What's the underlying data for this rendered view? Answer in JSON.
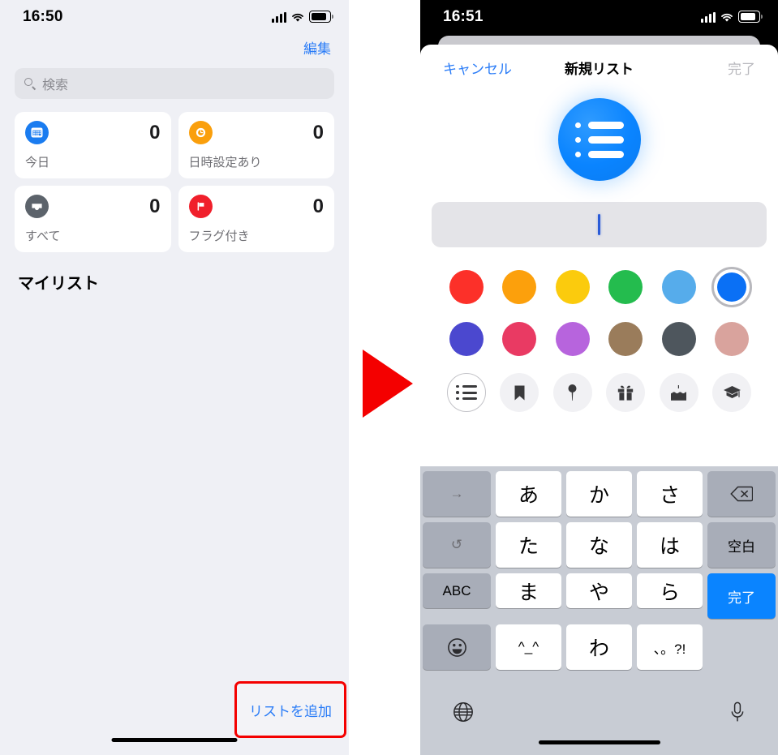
{
  "left_phone": {
    "status_bar": {
      "time": "16:50",
      "signal_icon": "cellular-bars-icon",
      "wifi_icon": "wifi-icon",
      "battery_icon": "battery-icon"
    },
    "edit_button": "編集",
    "search": {
      "placeholder": "検索",
      "icon": "search-icon"
    },
    "cards": [
      {
        "label": "今日",
        "count": "0",
        "icon": "calendar-icon",
        "color": "#1a7cf0"
      },
      {
        "label": "日時設定あり",
        "count": "0",
        "icon": "clock-icon",
        "color": "#fa9f0c"
      },
      {
        "label": "すべて",
        "count": "0",
        "icon": "inbox-icon",
        "color": "#5c636b"
      },
      {
        "label": "フラグ付き",
        "count": "0",
        "icon": "flag-icon",
        "color": "#f01f2b"
      }
    ],
    "my_lists_heading": "マイリスト",
    "add_list_button": "リストを追加",
    "annotation_color": "#f40000"
  },
  "arrow": {
    "name": "red-right-arrow",
    "color": "#f40000"
  },
  "right_phone": {
    "status_bar": {
      "time": "16:51",
      "signal_icon": "cellular-bars-icon",
      "wifi_icon": "wifi-icon",
      "battery_icon": "battery-icon"
    },
    "sheet_header": {
      "cancel": "キャンセル",
      "title": "新規リスト",
      "done": "完了"
    },
    "preview_icon": {
      "name": "list-icon",
      "color": "#0a84ff"
    },
    "name_field": {
      "value": "",
      "placeholder": ""
    },
    "colors": [
      {
        "name": "red",
        "hex": "#fc3029",
        "selected": false
      },
      {
        "name": "orange",
        "hex": "#fca00c",
        "selected": false
      },
      {
        "name": "yellow",
        "hex": "#fbcb0d",
        "selected": false
      },
      {
        "name": "green",
        "hex": "#24bc4e",
        "selected": false
      },
      {
        "name": "light-blue",
        "hex": "#56aceb",
        "selected": false
      },
      {
        "name": "blue",
        "hex": "#0a70f5",
        "selected": true
      },
      {
        "name": "indigo",
        "hex": "#4b48cf",
        "selected": false
      },
      {
        "name": "pink",
        "hex": "#e93a63",
        "selected": false
      },
      {
        "name": "purple",
        "hex": "#b764dd",
        "selected": false
      },
      {
        "name": "brown",
        "hex": "#9a7c5b",
        "selected": false
      },
      {
        "name": "dark-gray",
        "hex": "#4e565d",
        "selected": false
      },
      {
        "name": "dusty-rose",
        "hex": "#d9a39d",
        "selected": false
      }
    ],
    "icons": [
      {
        "name": "list-icon",
        "glyph": "",
        "selected": true
      },
      {
        "name": "bookmark-icon",
        "glyph": "🔖",
        "selected": false
      },
      {
        "name": "pin-icon",
        "glyph": "📍",
        "selected": false
      },
      {
        "name": "gift-icon",
        "glyph": "🎁",
        "selected": false
      },
      {
        "name": "cake-icon",
        "glyph": "🎂",
        "selected": false
      },
      {
        "name": "graduation-cap-icon",
        "glyph": "🎓",
        "selected": false
      }
    ],
    "keyboard": {
      "rows": [
        [
          "→",
          "あ",
          "か",
          "さ",
          "⌫"
        ],
        [
          "↺",
          "た",
          "な",
          "は",
          "空白"
        ],
        [
          "ABC",
          "ま",
          "や",
          "ら",
          "完了"
        ],
        [
          "☺",
          "^_^",
          "わ",
          "、。?!",
          ""
        ]
      ],
      "globe_icon": "globe-icon",
      "mic_icon": "microphone-icon",
      "return_key_color": "#0a84ff"
    }
  }
}
